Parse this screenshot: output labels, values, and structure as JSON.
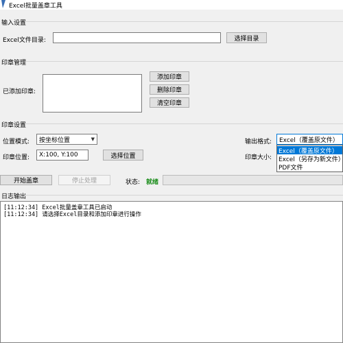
{
  "window": {
    "title": "Excel批量盖章工具"
  },
  "input_group": {
    "title": "输入设置",
    "dir_label": "Excel文件目录:",
    "dir_value": "",
    "browse_label": "选择目录"
  },
  "stamp_group": {
    "title": "印章管理",
    "added_label": "已添加印章:",
    "add_label": "添加印章",
    "delete_label": "删除印章",
    "clear_label": "清空印章"
  },
  "settings_group": {
    "title": "印章设置",
    "mode_label": "位置模式:",
    "mode_value": "按坐标位置",
    "pos_label": "印章位置:",
    "pos_value": "X:100, Y:100",
    "pick_pos_label": "选择位置",
    "output_label": "输出格式:",
    "output_value": "Excel（覆盖原文件）",
    "size_label": "印章大小:",
    "output_options": [
      "Excel（覆盖原文件）",
      "Excel（另存为新文件）",
      "PDF文件"
    ],
    "output_selected_index": 0
  },
  "actions": {
    "start_label": "开始盖章",
    "stop_label": "停止处理",
    "status_label": "状态:",
    "status_value": "就绪",
    "progress": 0
  },
  "log_group": {
    "title": "日志输出",
    "lines": [
      "[11:12:34] Excel批量盖章工具已启动",
      "[11:12:34] 请选择Excel目录和添加印章进行操作"
    ]
  }
}
